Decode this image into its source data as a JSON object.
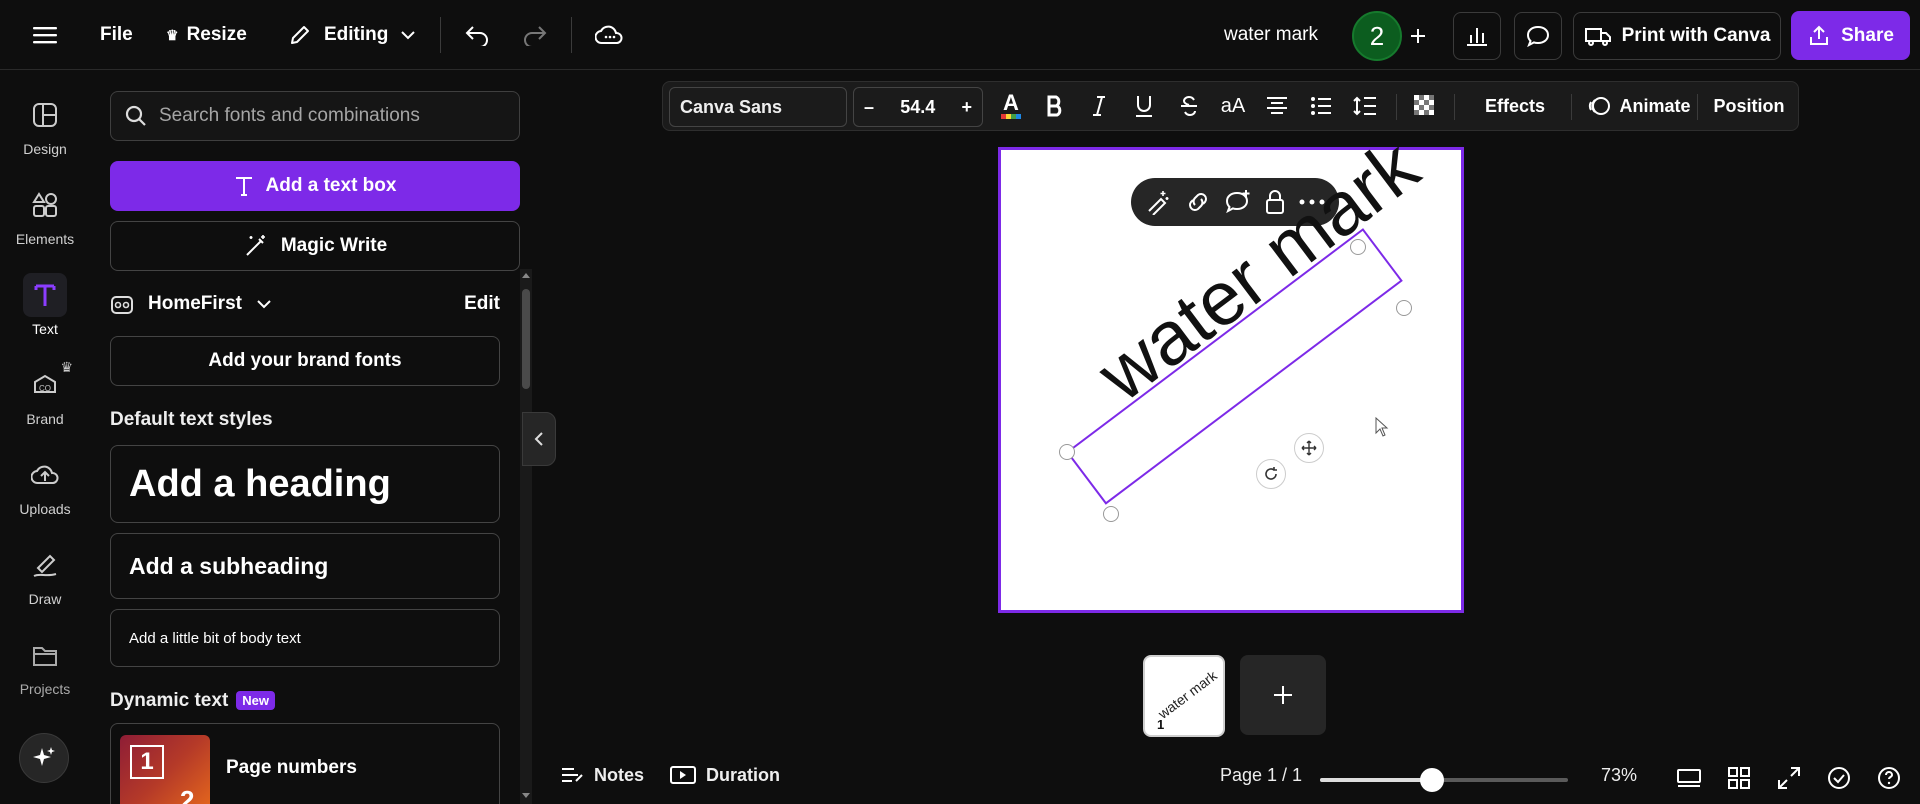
{
  "topbar": {
    "file_label": "File",
    "resize_label": "Resize",
    "editing_label": "Editing",
    "doc_title": "water mark",
    "collaborator_count": "2",
    "print_label": "Print with Canva",
    "share_label": "Share"
  },
  "rail": {
    "items": [
      {
        "label": "Design",
        "icon": "design-icon"
      },
      {
        "label": "Elements",
        "icon": "elements-icon"
      },
      {
        "label": "Text",
        "icon": "text-icon"
      },
      {
        "label": "Brand",
        "icon": "brand-icon"
      },
      {
        "label": "Uploads",
        "icon": "uploads-icon"
      },
      {
        "label": "Draw",
        "icon": "draw-icon"
      },
      {
        "label": "Projects",
        "icon": "projects-icon"
      }
    ],
    "active": "Text"
  },
  "panel": {
    "search_placeholder": "Search fonts and combinations",
    "add_text_box": "Add a text box",
    "magic_write": "Magic Write",
    "brand_kit": "HomeFirst",
    "edit_label": "Edit",
    "add_brand_fonts": "Add your brand fonts",
    "default_styles_title": "Default text styles",
    "heading": "Add a heading",
    "subheading": "Add a subheading",
    "body": "Add a little bit of body text",
    "dynamic_title": "Dynamic text",
    "new_badge": "New",
    "page_numbers": "Page numbers",
    "page_numbers_thumb_num": "1",
    "page_numbers_thumb_num2": "2"
  },
  "format_bar": {
    "font": "Canva Sans",
    "size": "54.4",
    "minus": "–",
    "plus": "+",
    "case_label": "aA",
    "effects": "Effects",
    "animate": "Animate",
    "position": "Position"
  },
  "canvas": {
    "text": "water mark",
    "thumb_text": "water mark",
    "thumb_page_number": "1"
  },
  "bottom": {
    "notes": "Notes",
    "duration": "Duration",
    "page_indicator": "Page 1 / 1",
    "zoom_level": "73%",
    "zoom_fraction": 0.45
  },
  "colors": {
    "accent": "#7d2ae8",
    "background": "#0e0e0e",
    "avatar": "#0c5d1f"
  }
}
